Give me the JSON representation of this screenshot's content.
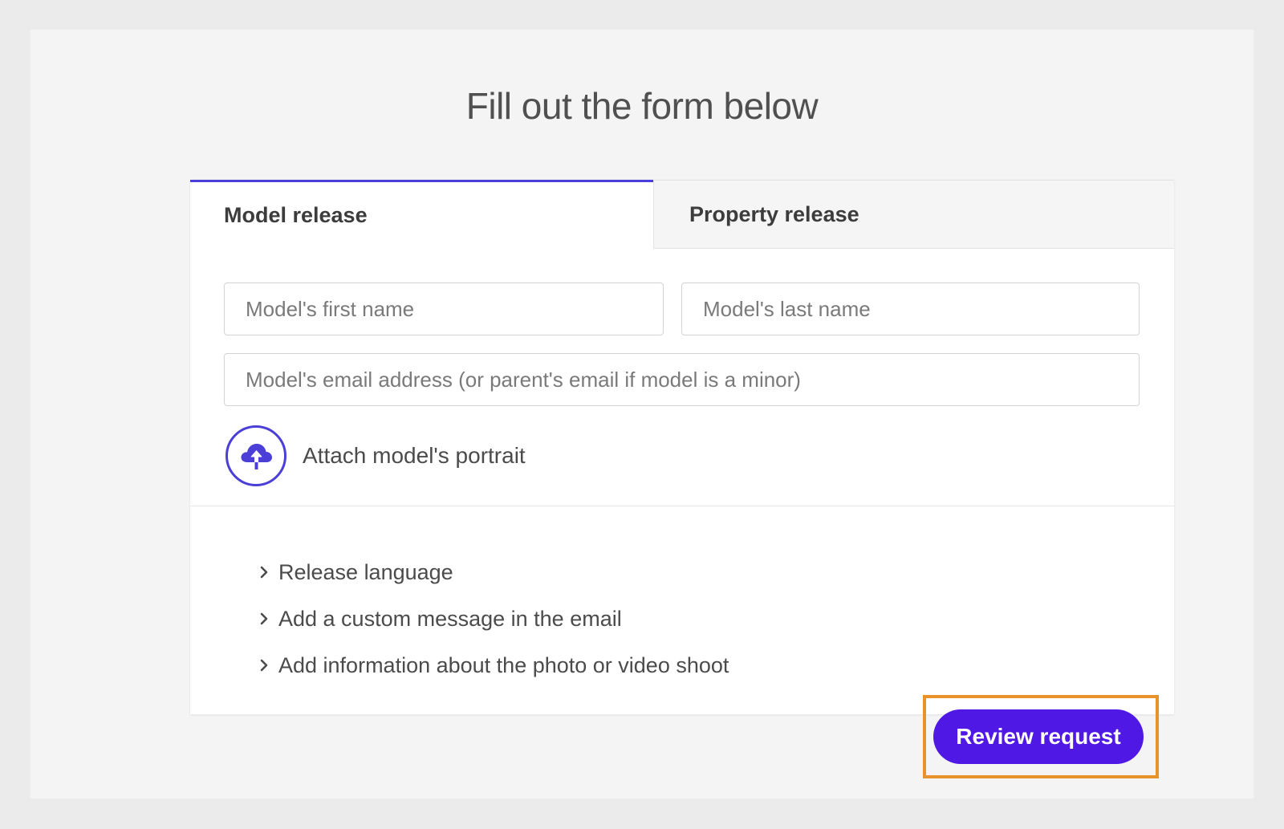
{
  "page": {
    "title": "Fill out the form below"
  },
  "tabs": [
    {
      "label": "Model release",
      "active": true
    },
    {
      "label": "Property release",
      "active": false
    }
  ],
  "form": {
    "first_name": {
      "placeholder": "Model's first name",
      "value": ""
    },
    "last_name": {
      "placeholder": "Model's last name",
      "value": ""
    },
    "email": {
      "placeholder": "Model's email address (or parent's email if model is a minor)",
      "value": ""
    },
    "attach_label": "Attach model's portrait",
    "attach_icon": "cloud-upload-icon"
  },
  "expanders": [
    {
      "label": "Release language",
      "icon": "chevron-right-icon"
    },
    {
      "label": "Add a custom message in the email",
      "icon": "chevron-right-icon"
    },
    {
      "label": "Add information about the photo or video shoot",
      "icon": "chevron-right-icon"
    }
  ],
  "actions": {
    "review_label": "Review request"
  },
  "colors": {
    "accent": "#4b3fd8",
    "button": "#4f18e4",
    "highlight": "#e8922a"
  }
}
